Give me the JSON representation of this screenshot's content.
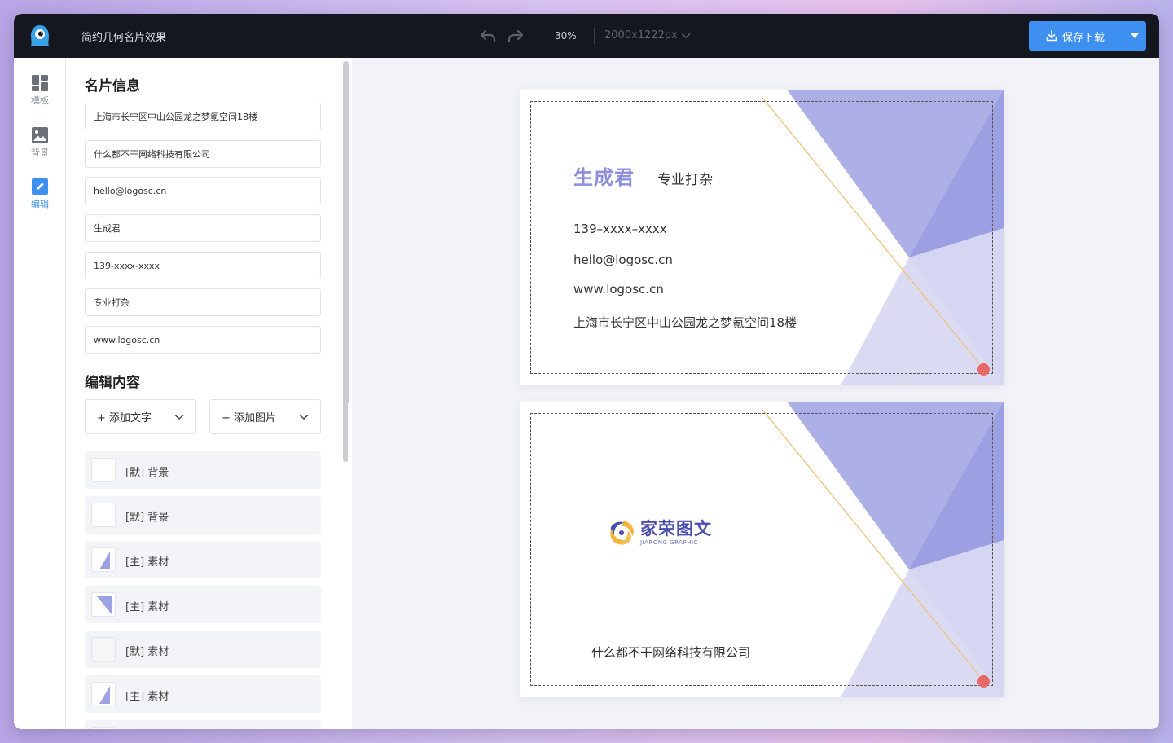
{
  "topbar": {
    "doc_title": "简约几何名片效果",
    "zoom": "30%",
    "canvas_size": "2000x1222px",
    "save_label": "保存下载"
  },
  "rail": {
    "items": [
      {
        "label": "模板"
      },
      {
        "label": "背景"
      },
      {
        "label": "编辑"
      }
    ]
  },
  "panel": {
    "info_title": "名片信息",
    "fields": [
      {
        "value": "上海市长宁区中山公园龙之梦氪空间18楼"
      },
      {
        "value": "什么都不干网络科技有限公司"
      },
      {
        "value": "hello@logosc.cn"
      },
      {
        "value": "生成君"
      },
      {
        "value": "139-xxxx-xxxx"
      },
      {
        "value": "专业打杂"
      },
      {
        "value": "www.logosc.cn"
      }
    ],
    "edit_title": "编辑内容",
    "add_text": "+ 添加文字",
    "add_image": "+ 添加图片",
    "layers": [
      {
        "label": "[默] 背景"
      },
      {
        "label": "[默] 背景"
      },
      {
        "label": "[主] 素材"
      },
      {
        "label": "[主] 素材"
      },
      {
        "label": "[默] 素材"
      },
      {
        "label": "[主] 素材"
      }
    ]
  },
  "front": {
    "name": "生成君",
    "role": "专业打杂",
    "phone": "139–xxxx–xxxx",
    "email": "hello@logosc.cn",
    "website": "www.logosc.cn",
    "address": "上海市长宁区中山公园龙之梦氪空间18楼"
  },
  "back": {
    "logo_cn": "家荣图文",
    "logo_en": "JIARONG GRAPHIC",
    "company": "什么都不干网络科技有限公司"
  },
  "colors": {
    "accent": "#3d8ff0",
    "violet": "#8d8fdc",
    "handle": "#e86868",
    "gold_line": "#f0c17a"
  }
}
